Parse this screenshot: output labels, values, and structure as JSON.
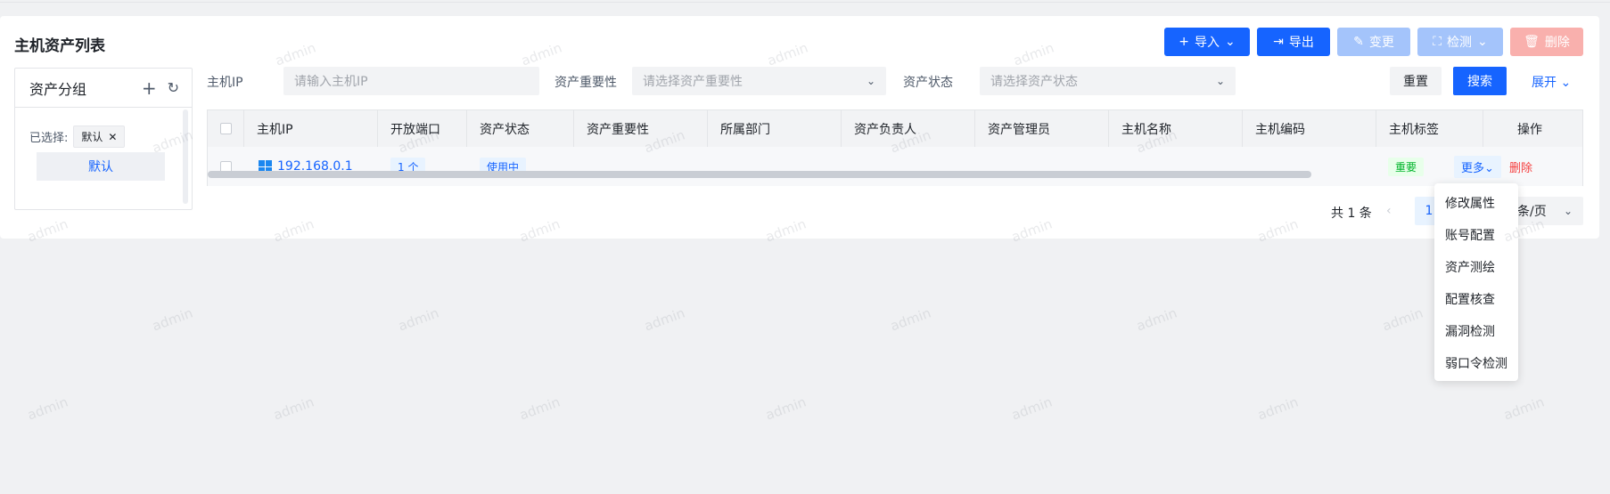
{
  "page": {
    "title": "主机资产列表"
  },
  "toolbar": {
    "import_label": "导入",
    "export_label": "导出",
    "change_label": "变更",
    "detect_label": "检测",
    "delete_label": "删除"
  },
  "group_panel": {
    "title": "资产分组",
    "selected_label": "已选择:",
    "selected_chip": "默认",
    "items": [
      {
        "label": "默认"
      }
    ]
  },
  "filters": {
    "host_ip": {
      "label": "主机IP",
      "placeholder": "请输入主机IP"
    },
    "importance": {
      "label": "资产重要性",
      "placeholder": "请选择资产重要性"
    },
    "status": {
      "label": "资产状态",
      "placeholder": "请选择资产状态"
    },
    "reset_label": "重置",
    "search_label": "搜索",
    "expand_label": "展开"
  },
  "table": {
    "columns": [
      "主机IP",
      "开放端口",
      "资产状态",
      "资产重要性",
      "所属部门",
      "资产负责人",
      "资产管理员",
      "主机名称",
      "主机编码",
      "主机标签",
      "操作"
    ],
    "rows": [
      {
        "host_ip": "192.168.0.1",
        "open_ports": "1 个",
        "status": "使用中",
        "importance": "",
        "department": "",
        "owner": "",
        "admin": "",
        "host_name": "",
        "host_code": "",
        "tag": "重要",
        "more_label": "更多",
        "delete_label": "删除"
      }
    ]
  },
  "pagination": {
    "total": "共 1 条",
    "prev": "‹",
    "current_page": "1",
    "page_size": "条/页"
  },
  "dropdown_menu": {
    "items": [
      "修改属性",
      "账号配置",
      "资产测绘",
      "配置核查",
      "漏洞检测",
      "弱口令检测"
    ]
  },
  "watermark": {
    "text": "admin"
  },
  "colors": {
    "primary": "#1664ff",
    "primary_disabled": "#a4c4fb",
    "danger_disabled": "#f9b0ad",
    "danger": "#f53f3f",
    "success": "#00b42a"
  }
}
